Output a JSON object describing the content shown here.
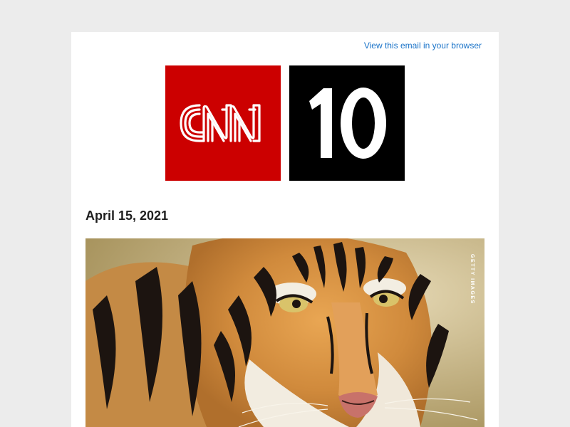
{
  "header": {
    "view_in_browser": "View this email in your browser"
  },
  "logo": {
    "left_mark": "CNN",
    "right_mark": "10",
    "left_color": "#cc0000",
    "right_color": "#000000"
  },
  "email": {
    "date": "April 15, 2021"
  },
  "hero_image": {
    "subject": "tiger",
    "credit": "GETTY IMAGES"
  }
}
